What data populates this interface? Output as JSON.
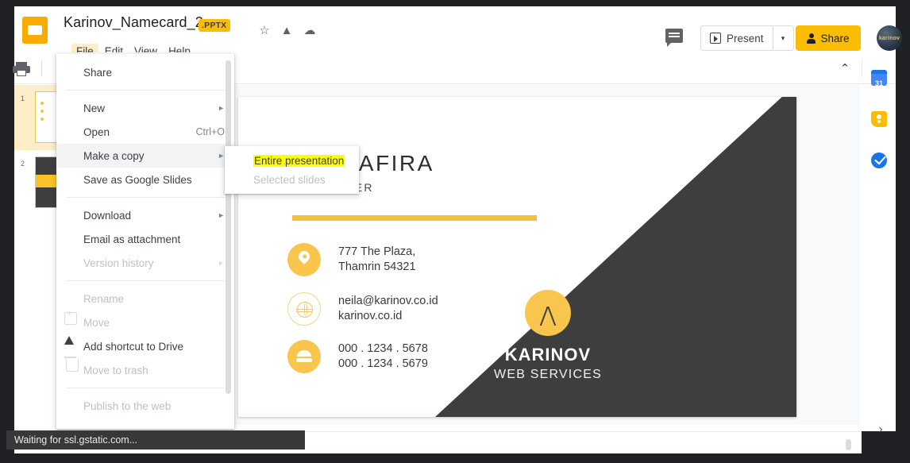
{
  "titlebar": {
    "doc_title": "Karinov_Namecard_2",
    "file_badge": ".PPTX",
    "star_icon": "star-icon",
    "drive_icon": "move-to-drive-icon",
    "cloud_icon": "cloud-saved-icon",
    "menus": [
      {
        "label": "File",
        "active": true
      },
      {
        "label": "Edit",
        "active": false
      },
      {
        "label": "View",
        "active": false
      },
      {
        "label": "Help",
        "active": false
      }
    ]
  },
  "toolbar": {
    "comment_icon": "comment-icon",
    "present_label": "Present",
    "present_caret": "▾",
    "share_label": "Share",
    "avatar_label": "karinov",
    "print_icon": "print-icon",
    "collapse_chevron": "⌃"
  },
  "file_menu": {
    "items": [
      {
        "label": "Share",
        "type": "item",
        "enabled": true,
        "accel": "",
        "arrow": "",
        "icon": ""
      },
      {
        "type": "separator"
      },
      {
        "label": "New",
        "type": "item",
        "enabled": true,
        "accel": "",
        "arrow": "►",
        "icon": ""
      },
      {
        "label": "Open",
        "type": "item",
        "enabled": true,
        "accel": "Ctrl+O",
        "arrow": "",
        "icon": ""
      },
      {
        "label": "Make a copy",
        "type": "item",
        "enabled": true,
        "accel": "",
        "arrow": "►",
        "icon": "",
        "hovered": true
      },
      {
        "label": "Save as Google Slides",
        "type": "item",
        "enabled": true,
        "accel": "",
        "arrow": "",
        "icon": ""
      },
      {
        "type": "separator"
      },
      {
        "label": "Download",
        "type": "item",
        "enabled": true,
        "accel": "",
        "arrow": "►",
        "icon": ""
      },
      {
        "label": "Email as attachment",
        "type": "item",
        "enabled": true,
        "accel": "",
        "arrow": "",
        "icon": ""
      },
      {
        "label": "Version history",
        "type": "item",
        "enabled": false,
        "accel": "",
        "arrow": "►",
        "icon": ""
      },
      {
        "type": "separator"
      },
      {
        "label": "Rename",
        "type": "item",
        "enabled": false,
        "accel": "",
        "arrow": "",
        "icon": ""
      },
      {
        "label": "Move",
        "type": "item",
        "enabled": false,
        "accel": "",
        "arrow": "",
        "icon": "move-folder-icon"
      },
      {
        "label": "Add shortcut to Drive",
        "type": "item",
        "enabled": true,
        "accel": "",
        "arrow": "",
        "icon": "drive-icon"
      },
      {
        "label": "Move to trash",
        "type": "item",
        "enabled": false,
        "accel": "",
        "arrow": "",
        "icon": "trash-icon"
      },
      {
        "type": "separator"
      },
      {
        "label": "Publish to the web",
        "type": "item",
        "enabled": false,
        "accel": "",
        "arrow": "",
        "icon": ""
      }
    ]
  },
  "make_a_copy_submenu": {
    "items": [
      {
        "label": "Entire presentation",
        "highlighted": true,
        "enabled": true
      },
      {
        "label": "Selected slides",
        "highlighted": false,
        "enabled": false
      }
    ]
  },
  "filmstrip": {
    "slides": [
      {
        "number": "1",
        "selected": true
      },
      {
        "number": "2",
        "selected": false
      }
    ]
  },
  "slide": {
    "name": "A SHAFIRA",
    "role": "DESIGNER",
    "contacts": [
      {
        "icon": "location-pin-icon",
        "line1": "777 The Plaza,",
        "line2": "Thamrin 54321"
      },
      {
        "icon": "globe-icon",
        "line1": "neila@karinov.co.id",
        "line2": "karinov.co.id"
      },
      {
        "icon": "phone-icon",
        "line1": "000 . 1234 . 5678",
        "line2": "000 . 1234 . 5679"
      }
    ],
    "logo": {
      "mark": "ʌ",
      "name": "KARINOV",
      "subtitle": "WEB SERVICES"
    }
  },
  "sidepanel": {
    "items": [
      {
        "name": "google-calendar-icon",
        "label": "31"
      },
      {
        "name": "google-keep-icon",
        "label": ""
      },
      {
        "name": "google-tasks-icon",
        "label": ""
      }
    ]
  },
  "notes": {
    "drag_handle": "•••",
    "expand_chevron": "›"
  },
  "statusbar": {
    "text": "Waiting for ssl.gstatic.com..."
  },
  "colors": {
    "brand_yellow": "#fbbc04",
    "slide_yellow": "#f9c54d",
    "slide_dark": "#3e3e3e",
    "highlight": "#ffff00",
    "menu_text": "#3c4043",
    "disabled_text": "#bdc1c6"
  }
}
